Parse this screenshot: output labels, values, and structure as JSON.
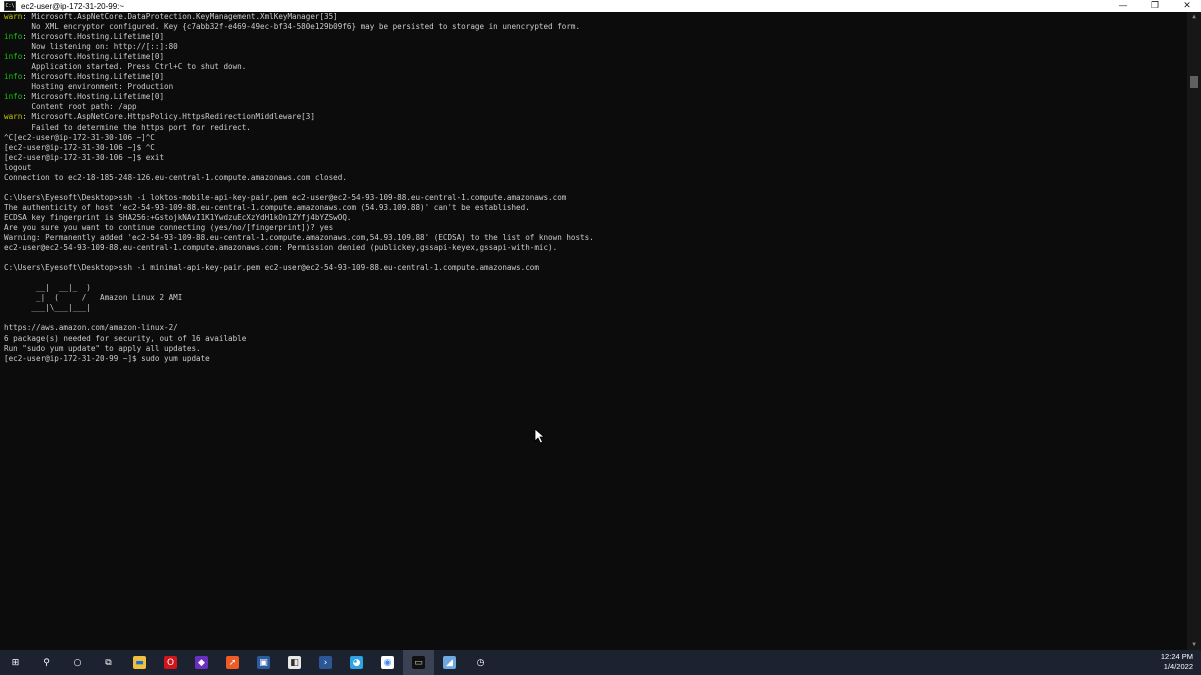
{
  "window": {
    "title": "ec2-user@ip-172-31-20-99:~",
    "app_icon_text": "C:\\",
    "minimize_glyph": "—",
    "maximize_glyph": "❐",
    "close_glyph": "✕"
  },
  "terminal": {
    "lines": [
      {
        "level": "warn",
        "text": ": Microsoft.AspNetCore.DataProtection.KeyManagement.XmlKeyManager[35]"
      },
      {
        "level": "",
        "text": "      No XML encryptor configured. Key {c7abb32f-e469-49ec-bf34-580e129b09f6} may be persisted to storage in unencrypted form."
      },
      {
        "level": "info",
        "text": ": Microsoft.Hosting.Lifetime[0]"
      },
      {
        "level": "",
        "text": "      Now listening on: http://[::]:80"
      },
      {
        "level": "info",
        "text": ": Microsoft.Hosting.Lifetime[0]"
      },
      {
        "level": "",
        "text": "      Application started. Press Ctrl+C to shut down."
      },
      {
        "level": "info",
        "text": ": Microsoft.Hosting.Lifetime[0]"
      },
      {
        "level": "",
        "text": "      Hosting environment: Production"
      },
      {
        "level": "info",
        "text": ": Microsoft.Hosting.Lifetime[0]"
      },
      {
        "level": "",
        "text": "      Content root path: /app"
      },
      {
        "level": "warn",
        "text": ": Microsoft.AspNetCore.HttpsPolicy.HttpsRedirectionMiddleware[3]"
      },
      {
        "level": "",
        "text": "      Failed to determine the https port for redirect."
      },
      {
        "level": "",
        "text": "^C[ec2-user@ip-172-31-30-106 ~]^C"
      },
      {
        "level": "",
        "text": "[ec2-user@ip-172-31-30-106 ~]$ ^C"
      },
      {
        "level": "",
        "text": "[ec2-user@ip-172-31-30-106 ~]$ exit"
      },
      {
        "level": "",
        "text": "logout"
      },
      {
        "level": "",
        "text": "Connection to ec2-18-185-248-126.eu-central-1.compute.amazonaws.com closed."
      },
      {
        "level": "",
        "text": ""
      },
      {
        "level": "",
        "text": "C:\\Users\\Eyesoft\\Desktop>ssh -i loktos-mobile-api-key-pair.pem ec2-user@ec2-54-93-109-88.eu-central-1.compute.amazonaws.com"
      },
      {
        "level": "",
        "text": "The authenticity of host 'ec2-54-93-109-88.eu-central-1.compute.amazonaws.com (54.93.109.88)' can't be established."
      },
      {
        "level": "",
        "text": "ECDSA key fingerprint is SHA256:+GstojkNAvI1K1YwdzuEcXzYdH1kOn1ZYfj4bYZSwOQ."
      },
      {
        "level": "",
        "text": "Are you sure you want to continue connecting (yes/no/[fingerprint])? yes"
      },
      {
        "level": "",
        "text": "Warning: Permanently added 'ec2-54-93-109-88.eu-central-1.compute.amazonaws.com,54.93.109.88' (ECDSA) to the list of known hosts."
      },
      {
        "level": "",
        "text": "ec2-user@ec2-54-93-109-88.eu-central-1.compute.amazonaws.com: Permission denied (publickey,gssapi-keyex,gssapi-with-mic)."
      },
      {
        "level": "",
        "text": ""
      },
      {
        "level": "",
        "text": "C:\\Users\\Eyesoft\\Desktop>ssh -i minimal-api-key-pair.pem ec2-user@ec2-54-93-109-88.eu-central-1.compute.amazonaws.com"
      },
      {
        "level": "",
        "text": ""
      },
      {
        "level": "",
        "text": "       __|  __|_  )"
      },
      {
        "level": "",
        "text": "       _|  (     /   Amazon Linux 2 AMI"
      },
      {
        "level": "",
        "text": "      ___|\\___|___|"
      },
      {
        "level": "",
        "text": ""
      },
      {
        "level": "",
        "text": "https://aws.amazon.com/amazon-linux-2/"
      },
      {
        "level": "",
        "text": "6 package(s) needed for security, out of 16 available"
      },
      {
        "level": "",
        "text": "Run \"sudo yum update\" to apply all updates."
      },
      {
        "level": "",
        "text": "[ec2-user@ip-172-31-20-99 ~]$ sudo yum update"
      }
    ],
    "level_labels": {
      "warn": "warn",
      "info": "info"
    },
    "colors": {
      "background": "#0c0c0c",
      "foreground": "#cccccc",
      "warn": "#c9c900",
      "info": "#16c60c"
    }
  },
  "scrollbar": {
    "up_glyph": "▲",
    "down_glyph": "▼"
  },
  "taskbar": {
    "items": [
      {
        "name": "start-button",
        "icon": "windows-logo-icon",
        "glyph": "⊞",
        "color": "transparent",
        "fg": "#ffffff",
        "active": false
      },
      {
        "name": "search-button",
        "icon": "search-icon",
        "glyph": "⚲",
        "color": "transparent",
        "fg": "#ffffff",
        "active": false
      },
      {
        "name": "cortana-button",
        "icon": "cortana-circle-icon",
        "glyph": "○",
        "color": "transparent",
        "fg": "#ffffff",
        "active": false
      },
      {
        "name": "task-view-button",
        "icon": "task-view-icon",
        "glyph": "⧉",
        "color": "transparent",
        "fg": "#ffffff",
        "active": false
      },
      {
        "name": "file-explorer-button",
        "icon": "folder-icon",
        "glyph": "▬",
        "color": "#f0c040",
        "fg": "#1e6fd0",
        "active": false
      },
      {
        "name": "opera-button",
        "icon": "opera-icon",
        "glyph": "O",
        "color": "#d1161b",
        "fg": "#ffffff",
        "active": false
      },
      {
        "name": "visual-studio-button",
        "icon": "visual-studio-icon",
        "glyph": "◆",
        "color": "#6b2fbf",
        "fg": "#ffffff",
        "active": false
      },
      {
        "name": "postman-button",
        "icon": "postman-icon",
        "glyph": "➚",
        "color": "#ef5b25",
        "fg": "#ffffff",
        "active": false
      },
      {
        "name": "app-blue-square-button",
        "icon": "blue-square-app-icon",
        "glyph": "▣",
        "color": "#2c5aa0",
        "fg": "#ffffff",
        "active": false
      },
      {
        "name": "app-gray-button",
        "icon": "gray-app-icon",
        "glyph": "◧",
        "color": "#e8e8e8",
        "fg": "#303030",
        "active": false
      },
      {
        "name": "powershell-button",
        "icon": "powershell-icon",
        "glyph": "›",
        "color": "#2b5797",
        "fg": "#ffffff",
        "active": false
      },
      {
        "name": "app-bird-button",
        "icon": "bird-app-icon",
        "glyph": "◕",
        "color": "#2ea3e3",
        "fg": "#ffffff",
        "active": false
      },
      {
        "name": "chrome-button",
        "icon": "chrome-icon",
        "glyph": "◉",
        "color": "#ffffff",
        "fg": "#4285f4",
        "active": false
      },
      {
        "name": "command-prompt-button",
        "icon": "command-prompt-icon",
        "glyph": "▭",
        "color": "#101010",
        "fg": "#cccccc",
        "active": true
      },
      {
        "name": "app-document-button",
        "icon": "document-app-icon",
        "glyph": "◢",
        "color": "#6fa8dc",
        "fg": "#ffffff",
        "active": false
      },
      {
        "name": "app-clock-button",
        "icon": "clock-app-icon",
        "glyph": "◷",
        "color": "transparent",
        "fg": "#ffffff",
        "active": false
      }
    ]
  },
  "clock": {
    "time": "12:24 PM",
    "date": "1/4/2022"
  }
}
